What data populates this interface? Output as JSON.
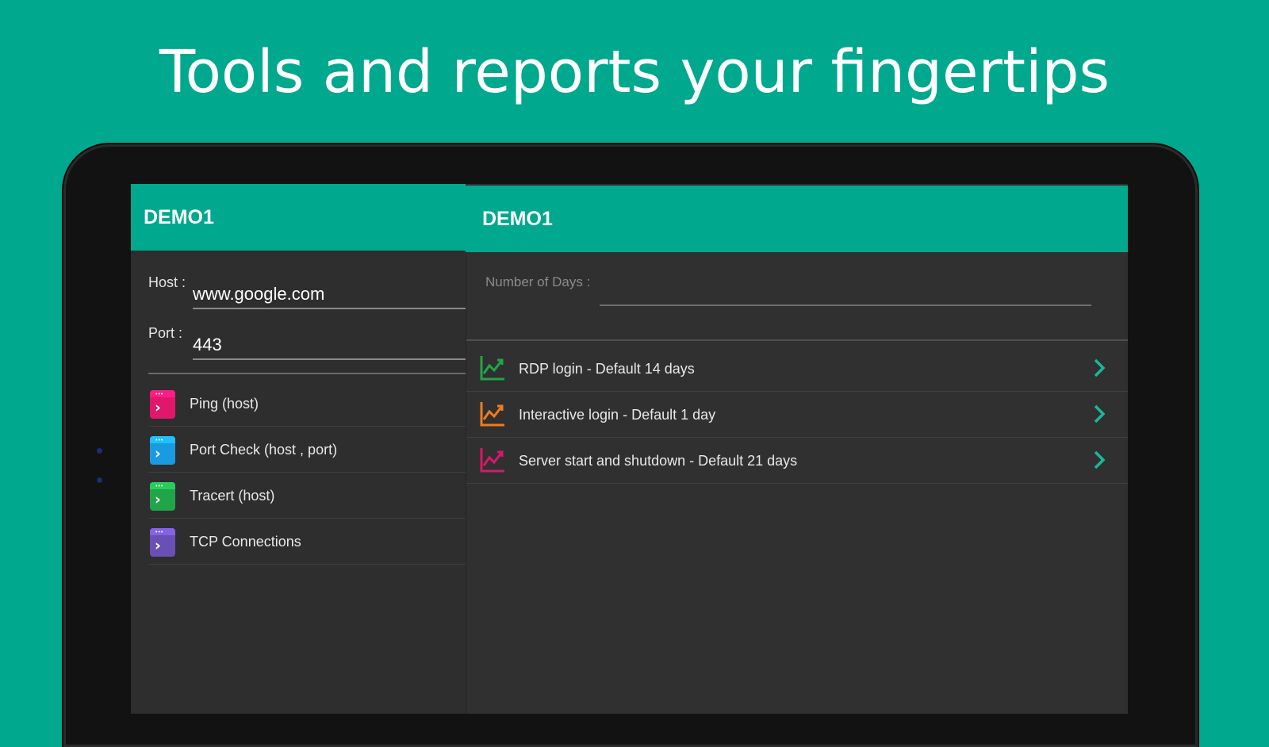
{
  "headline": "Tools and reports your fingertips",
  "left_panel": {
    "title": "DEMO1",
    "host_label": "Host :",
    "host_value": "www.google.com",
    "port_label": "Port :",
    "port_value": "443",
    "tools": [
      {
        "label": "Ping (host)",
        "icon": "terminal-icon",
        "color": "#e0176a"
      },
      {
        "label": "Port Check (host , port)",
        "icon": "terminal-icon",
        "color": "#1a9ae0"
      },
      {
        "label": "Tracert (host)",
        "icon": "terminal-icon",
        "color": "#21a548"
      },
      {
        "label": "TCP Connections",
        "icon": "terminal-icon",
        "color": "#6a4fb5"
      }
    ]
  },
  "right_panel": {
    "title": "DEMO1",
    "days_label": "Number of Days :",
    "days_value": "",
    "reports": [
      {
        "label": "RDP login - Default 14 days",
        "icon": "chart-trend-icon",
        "color": "#21a548"
      },
      {
        "label": "Interactive login - Default 1 day",
        "icon": "chart-trend-icon",
        "color": "#f07b1e"
      },
      {
        "label": "Server start and shutdown - Default 21 days",
        "icon": "chart-trend-icon",
        "color": "#d9176a"
      }
    ]
  },
  "colors": {
    "background": "#00a88e",
    "appbar": "#00a88e",
    "panel": "#2e2e2e",
    "chevron": "#19b89c"
  }
}
